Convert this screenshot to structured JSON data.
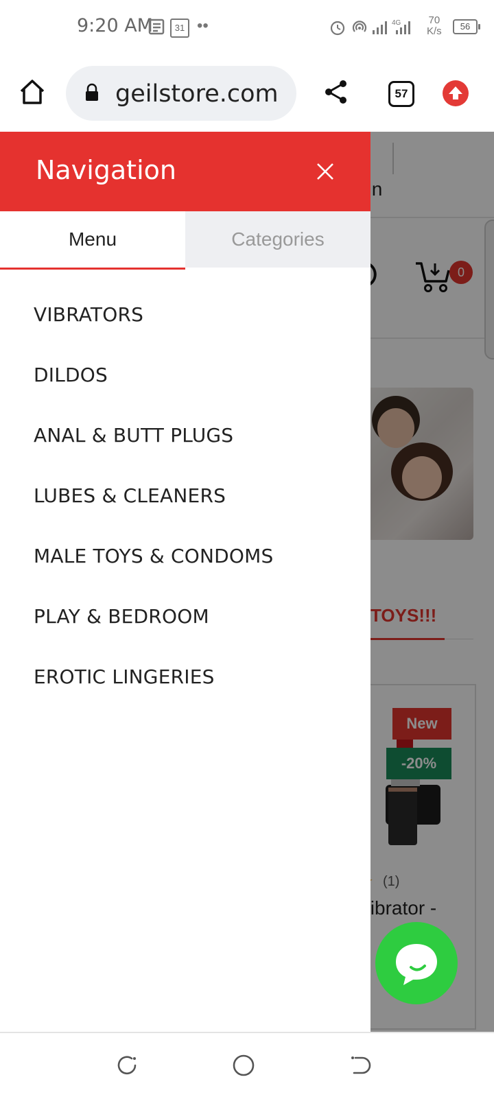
{
  "status_bar": {
    "time": "9:20 AM",
    "calendar_day": "31",
    "net_speed_value": "70",
    "net_speed_unit": "K/s",
    "battery": "56",
    "signal_label": "4G"
  },
  "browser": {
    "url": "geilstore.com",
    "tab_count": "57"
  },
  "background_page": {
    "login_label": "gin",
    "cart_count": "0",
    "section_title": "TOYS!!!",
    "badge_new": "New",
    "badge_discount": "-20%",
    "rating_count": "(1)",
    "product_name_fragment": "/ibrator -"
  },
  "drawer": {
    "title": "Navigation",
    "tabs": [
      {
        "label": "Menu",
        "active": true
      },
      {
        "label": "Categories",
        "active": false
      }
    ],
    "menu_items": [
      {
        "label": "VIBRATORS"
      },
      {
        "label": "DILDOS"
      },
      {
        "label": "ANAL & BUTT PLUGS"
      },
      {
        "label": "LUBES & CLEANERS"
      },
      {
        "label": "MALE TOYS & CONDOMS"
      },
      {
        "label": "PLAY & BEDROOM"
      },
      {
        "label": "EROTIC LINGERIES"
      }
    ]
  },
  "colors": {
    "accent_red": "#e5322f",
    "chat_green": "#2ecc40",
    "discount_green": "#1a8a5a"
  },
  "icons": [
    "home-icon",
    "lock-icon",
    "share-icon",
    "tabs-icon",
    "upload-icon",
    "close-icon",
    "cart-icon",
    "chat-icon",
    "recents-icon",
    "home-circle-icon",
    "back-icon",
    "alarm-icon",
    "hotspot-icon",
    "signal-icon",
    "battery-icon"
  ]
}
